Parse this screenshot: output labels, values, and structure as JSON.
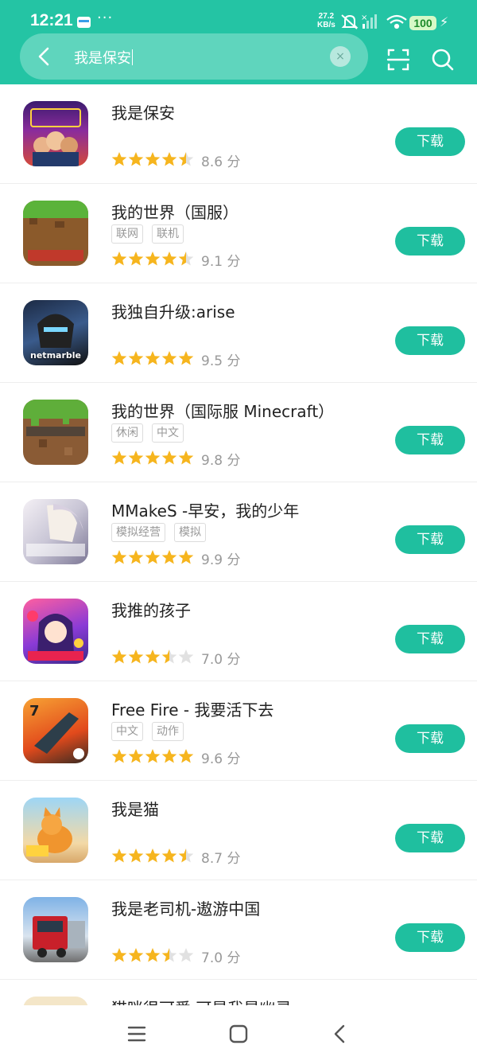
{
  "status_bar": {
    "time": "12:21",
    "dots": "···",
    "net_speed_value": "27.2",
    "net_speed_unit": "KB/s",
    "battery": "100",
    "icons": [
      "card-icon",
      "mute-icon",
      "signal-icon",
      "wifi-icon",
      "battery-icon",
      "charging-icon"
    ]
  },
  "search": {
    "query": "我是保安",
    "clear_icon": "×"
  },
  "colors": {
    "accent": "#24c4a4",
    "button": "#1fbf9f",
    "star": "#f6b51e",
    "star_empty": "#e1e1e1"
  },
  "results": [
    {
      "name": "我是保安",
      "tags": [],
      "rating": 4.5,
      "score": "8.6 分",
      "button": "下载",
      "icon_text": ""
    },
    {
      "name": "我的世界（国服）",
      "tags": [
        "联网",
        "联机"
      ],
      "rating": 4.5,
      "score": "9.1 分",
      "button": "下载",
      "icon_text": ""
    },
    {
      "name": "我独自升级:arise",
      "tags": [],
      "rating": 5,
      "score": "9.5 分",
      "button": "下载",
      "icon_text": "netmarble"
    },
    {
      "name": "我的世界（国际服 Minecraft）",
      "tags": [
        "休闲",
        "中文"
      ],
      "rating": 5,
      "score": "9.8 分",
      "button": "下载",
      "icon_text": ""
    },
    {
      "name": "MMakeS -早安，我的少年",
      "tags": [
        "模拟经营",
        "模拟"
      ],
      "rating": 5,
      "score": "9.9 分",
      "button": "下载",
      "icon_text": ""
    },
    {
      "name": "我推的孩子",
      "tags": [],
      "rating": 3.5,
      "score": "7.0 分",
      "button": "下载",
      "icon_text": ""
    },
    {
      "name": "Free Fire - 我要活下去",
      "tags": [
        "中文",
        "动作"
      ],
      "rating": 5,
      "score": "9.6 分",
      "button": "下载",
      "icon_text": ""
    },
    {
      "name": "我是猫",
      "tags": [],
      "rating": 4.5,
      "score": "8.7 分",
      "button": "下载",
      "icon_text": ""
    },
    {
      "name": "我是老司机-遨游中国",
      "tags": [],
      "rating": 3.5,
      "score": "7.0 分",
      "button": "下载",
      "icon_text": ""
    },
    {
      "name": "猫咪很可爱 可是我是幽灵",
      "tags": [],
      "rating": 0,
      "score": "",
      "button": "",
      "icon_text": ""
    }
  ],
  "nav_bar": {
    "icons": [
      "menu-icon",
      "home-icon",
      "back-icon"
    ]
  }
}
